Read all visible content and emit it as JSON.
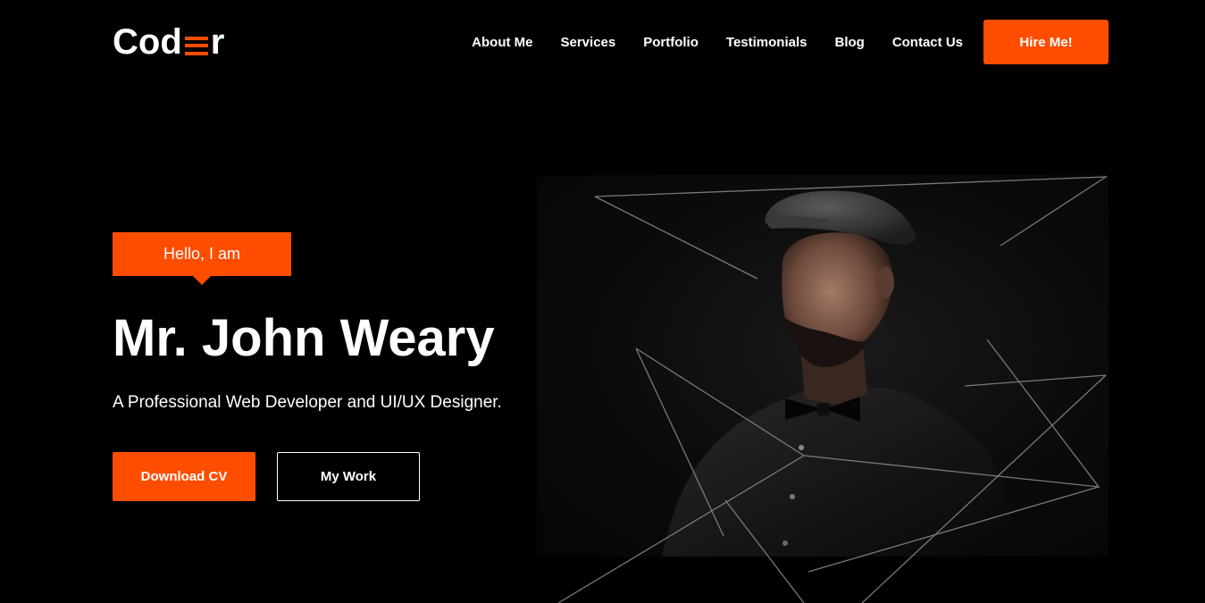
{
  "brand": {
    "logo_start": "Cod",
    "logo_end": "r",
    "accent_color": "#ff4d00"
  },
  "nav": {
    "items": [
      "About Me",
      "Services",
      "Portfolio",
      "Testimonials",
      "Blog",
      "Contact Us"
    ],
    "cta_label": "Hire Me!"
  },
  "hero": {
    "greeting": "Hello, I am",
    "name": "Mr. John Weary",
    "subtitle": "A Professional Web Developer and UI/UX Designer.",
    "primary_button": "Download CV",
    "secondary_button": "My Work",
    "photo_icon": "portrait-photo"
  }
}
